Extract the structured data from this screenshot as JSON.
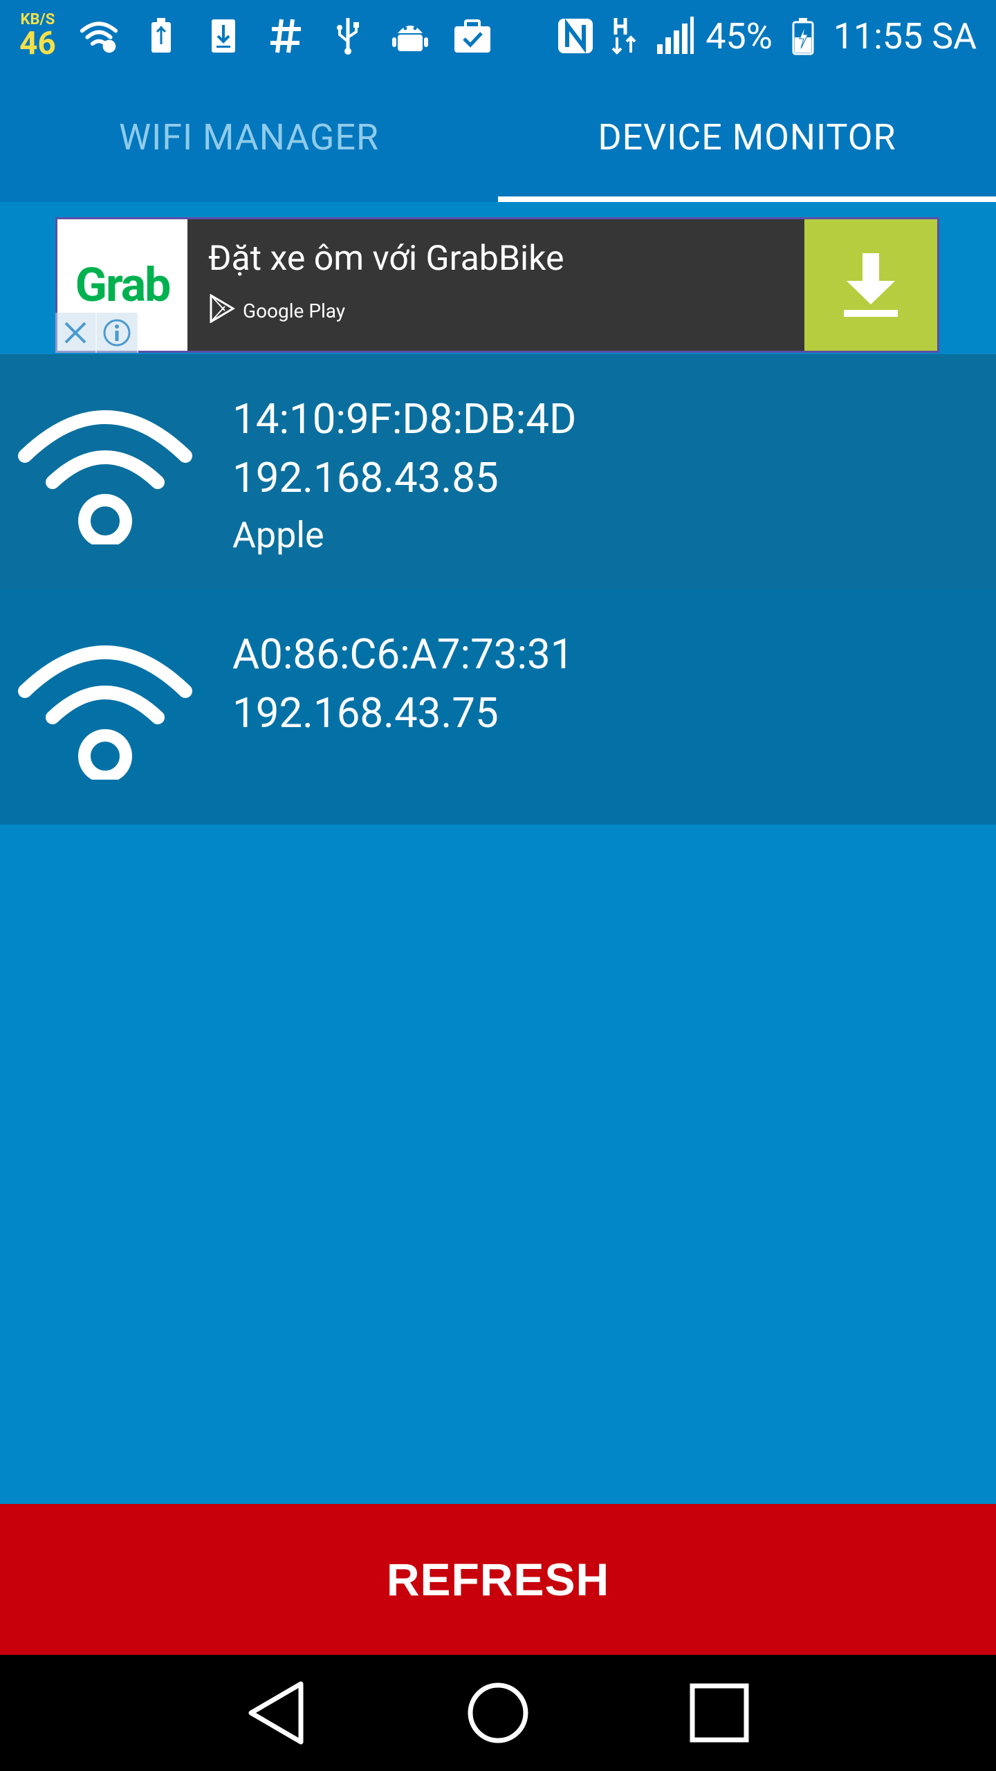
{
  "status_bar": {
    "speed_unit": "KB/S",
    "speed_value": "46",
    "battery_percent": "45%",
    "time": "11:55 SA"
  },
  "tabs": [
    {
      "label": "WIFI MANAGER",
      "active": false
    },
    {
      "label": "DEVICE MONITOR",
      "active": true
    }
  ],
  "ad": {
    "logo_text": "Grab",
    "title": "Đặt xe ôm với GrabBike",
    "store_label": "Google Play"
  },
  "devices": [
    {
      "mac": "14:10:9F:D8:DB:4D",
      "ip": "192.168.43.85",
      "vendor": "Apple"
    },
    {
      "mac": "A0:86:C6:A7:73:31",
      "ip": "192.168.43.75",
      "vendor": ""
    }
  ],
  "refresh_label": "REFRESH",
  "colors": {
    "app_bar": "#0277bd",
    "background": "#0288c9",
    "refresh": "#c8000b",
    "ad_button": "#b5cd3f"
  }
}
